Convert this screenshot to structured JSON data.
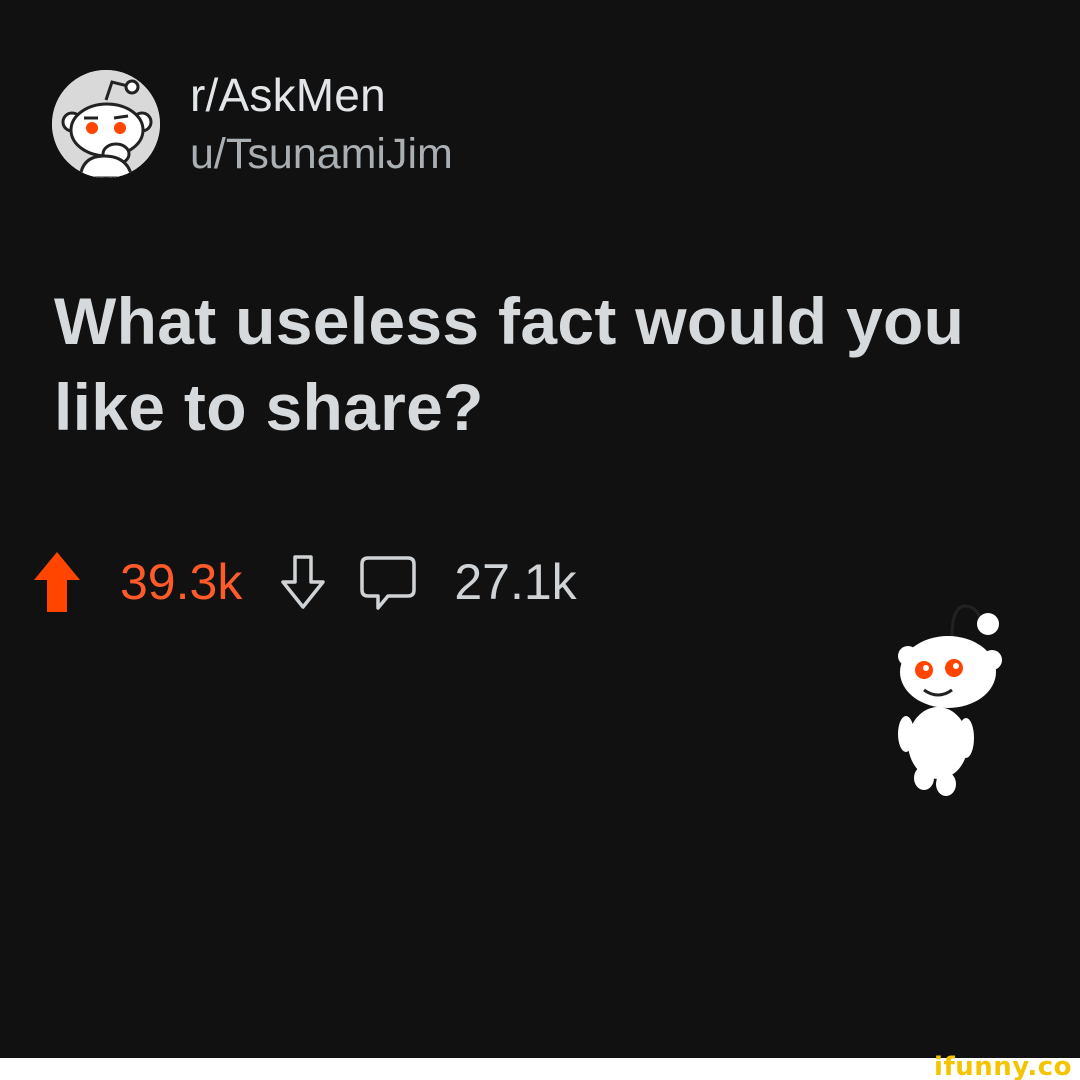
{
  "post": {
    "subreddit": "r/AskMen",
    "username": "u/TsunamiJim",
    "title": "What useless fact would you like to share?",
    "upvotes": "39.3k",
    "comments": "27.1k"
  },
  "icons": {
    "avatar": "snoo-thinking-avatar",
    "upvote": "arrow-up-icon",
    "downvote": "arrow-down-icon",
    "comment": "comment-bubble-icon",
    "mascot": "snoo-mascot"
  },
  "colors": {
    "background": "#111111",
    "upvote": "#ff4500",
    "upvote_text": "#ff5b2a",
    "text_primary": "#d7dadc",
    "text_secondary": "#a9afb3",
    "watermark": "#f5c400"
  },
  "watermark": {
    "text": "ifunny.co"
  }
}
